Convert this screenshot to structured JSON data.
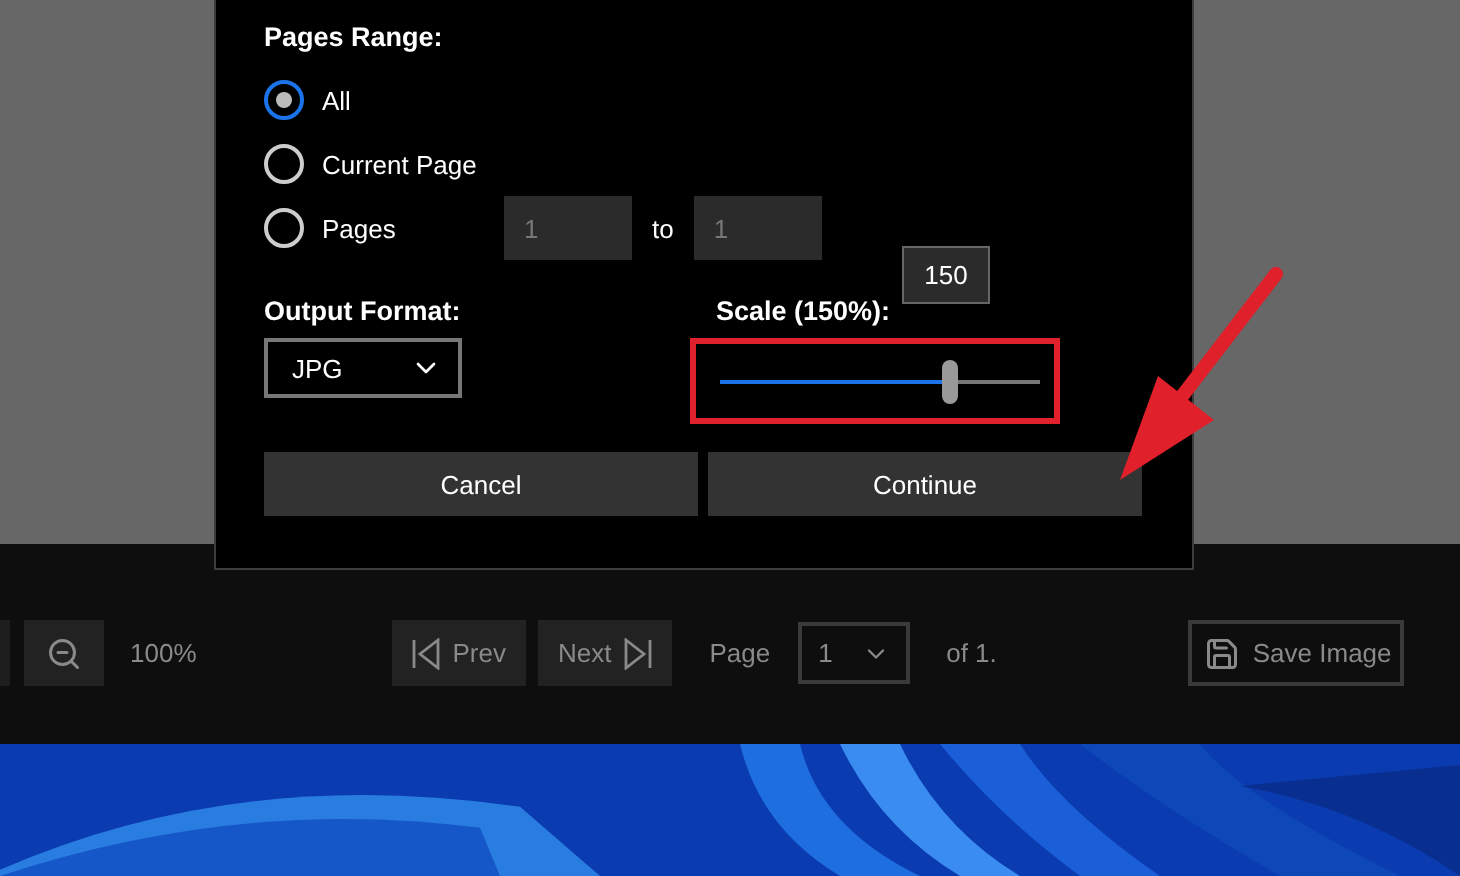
{
  "dialog": {
    "pages_range_label": "Pages Range:",
    "range_options": [
      {
        "label": "All",
        "selected": true
      },
      {
        "label": "Current Page",
        "selected": false
      },
      {
        "label": "Pages",
        "selected": false
      }
    ],
    "pages_from": "1",
    "pages_to_label": "to",
    "pages_to": "1",
    "output_format_label": "Output Format:",
    "output_format": "JPG",
    "scale_label": "Scale (150%):",
    "scale_tooltip": "150",
    "scale": {
      "level": 0.72
    },
    "buttons": [
      "Cancel",
      "Continue"
    ]
  },
  "toolbar": {
    "zoom": "100%",
    "prev": "Prev",
    "next": "Next",
    "page_label": "Page",
    "page": "1",
    "of_pages": "of 1.",
    "save": "Save Image"
  }
}
